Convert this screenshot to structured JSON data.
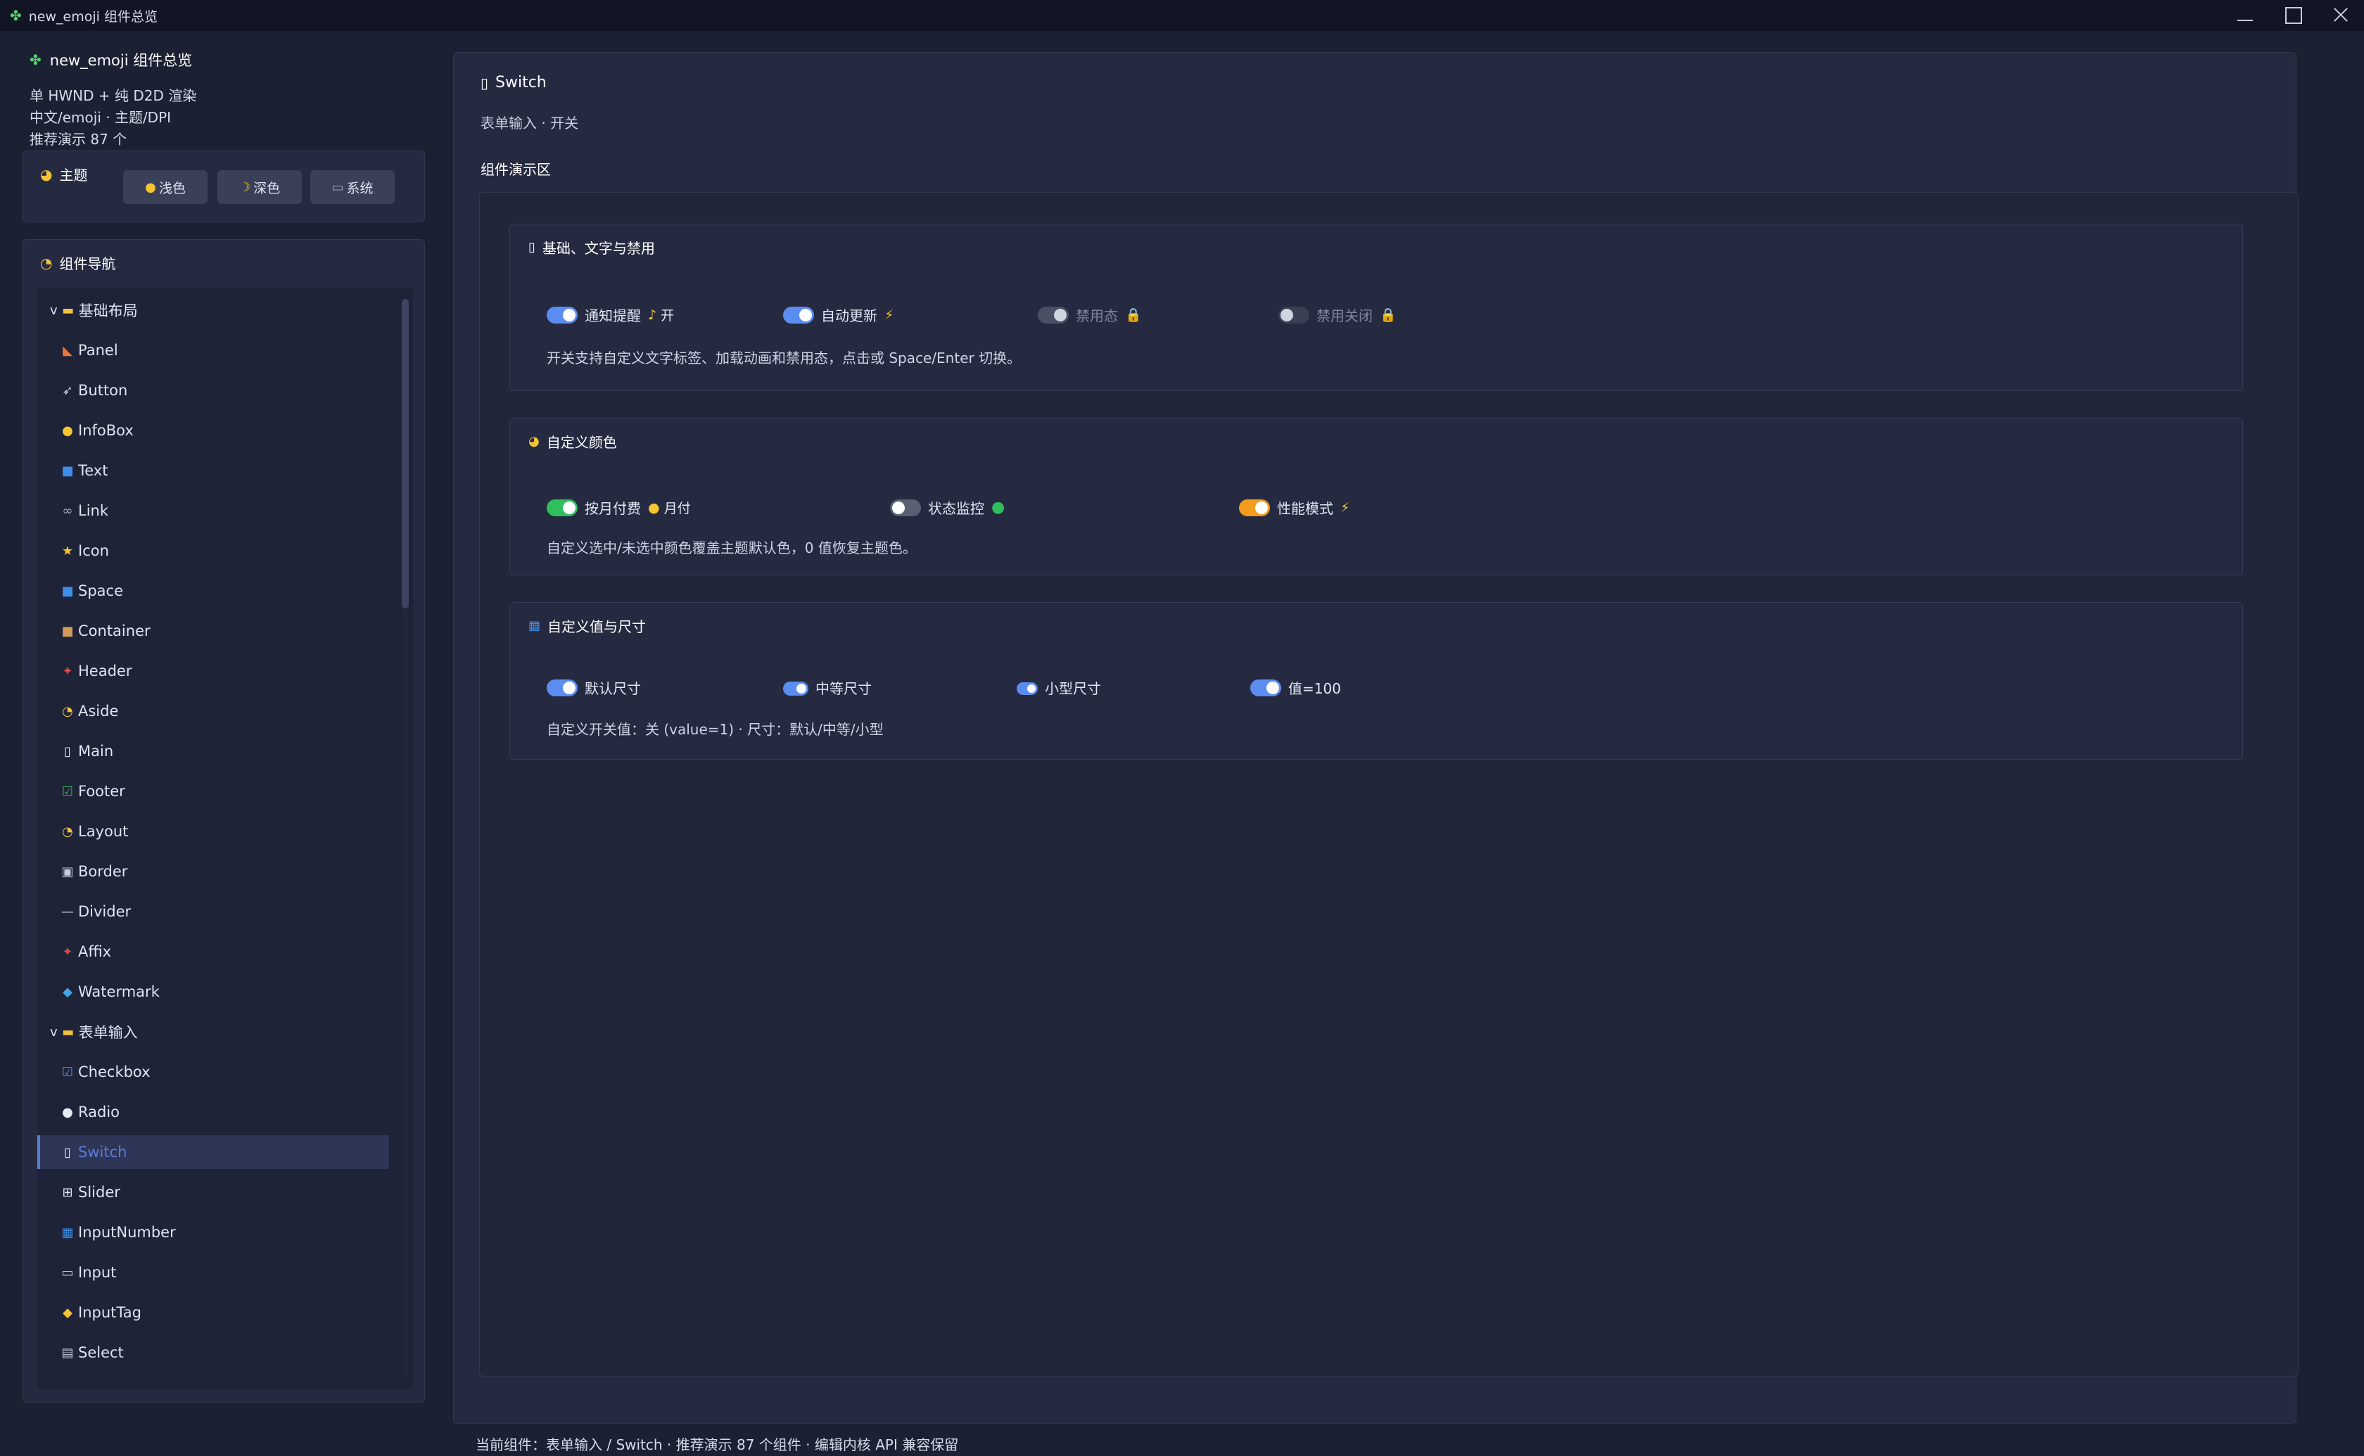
{
  "window": {
    "title": "new_emoji 组件总览"
  },
  "sidebar": {
    "app_title": "new_emoji 组件总览",
    "info_lines": [
      "单 HWND + 纯 D2D 渲染",
      "中文/emoji · 主题/DPI",
      "推荐演示 87 个"
    ],
    "theme": {
      "label": "主题",
      "buttons": [
        {
          "label": "浅色"
        },
        {
          "label": "深色"
        },
        {
          "label": "系统"
        }
      ]
    },
    "nav": {
      "label": "组件导航",
      "items": [
        {
          "label": "基础布局",
          "group": true
        },
        {
          "label": "Panel"
        },
        {
          "label": "Button"
        },
        {
          "label": "InfoBox"
        },
        {
          "label": "Text"
        },
        {
          "label": "Link"
        },
        {
          "label": "Icon"
        },
        {
          "label": "Space"
        },
        {
          "label": "Container"
        },
        {
          "label": "Header"
        },
        {
          "label": "Aside"
        },
        {
          "label": "Main"
        },
        {
          "label": "Footer"
        },
        {
          "label": "Layout"
        },
        {
          "label": "Border"
        },
        {
          "label": "Divider"
        },
        {
          "label": "Affix"
        },
        {
          "label": "Watermark"
        },
        {
          "label": "表单输入",
          "group": true
        },
        {
          "label": "Checkbox"
        },
        {
          "label": "Radio"
        },
        {
          "label": "Switch",
          "selected": true
        },
        {
          "label": "Slider"
        },
        {
          "label": "InputNumber"
        },
        {
          "label": "Input"
        },
        {
          "label": "InputTag"
        },
        {
          "label": "Select"
        }
      ],
      "caret": "v"
    }
  },
  "main": {
    "title": "Switch",
    "subtitle": "表单输入 · 开关",
    "demo_label": "组件演示区",
    "cards": [
      {
        "title": "基础、文字与禁用",
        "switches": [
          {
            "label": "通知提醒",
            "suffix": "开",
            "on": true,
            "disabled": false
          },
          {
            "label": "自动更新",
            "suffix": "",
            "on": true,
            "disabled": false
          },
          {
            "label": "禁用态",
            "suffix": "",
            "on": true,
            "disabled": true
          },
          {
            "label": "禁用关闭",
            "suffix": "",
            "on": false,
            "disabled": true
          }
        ],
        "desc": "开关支持自定义文字标签、加载动画和禁用态，点击或 Space/Enter 切换。"
      },
      {
        "title": "自定义颜色",
        "switches": [
          {
            "label": "按月付费",
            "suffix": "月付",
            "on": true,
            "color": "#2fbf5b"
          },
          {
            "label": "状态监控",
            "suffix": "",
            "on": false,
            "color": "#5a6072"
          },
          {
            "label": "性能模式",
            "suffix": "",
            "on": true,
            "color": "#f39c1f"
          }
        ],
        "desc": "自定义选中/未选中颜色覆盖主题默认色，0 值恢复主题色。"
      },
      {
        "title": "自定义值与尺寸",
        "switches": [
          {
            "label": "默认尺寸",
            "on": true
          },
          {
            "label": "中等尺寸",
            "on": true
          },
          {
            "label": "小型尺寸",
            "on": true
          },
          {
            "label": "值=100",
            "on": true
          }
        ],
        "desc": "自定义开关值：关 (value=1) · 尺寸：默认/中等/小型"
      }
    ]
  },
  "statusbar": {
    "text": "当前组件：表单输入 / Switch · 推荐演示 87 个组件 · 编辑内核 API 兼容保留"
  },
  "colors": {
    "accent": "#5a7bd8",
    "switch_on": "#5b8cf0",
    "green": "#2fbf5b",
    "orange": "#f39c1f"
  }
}
